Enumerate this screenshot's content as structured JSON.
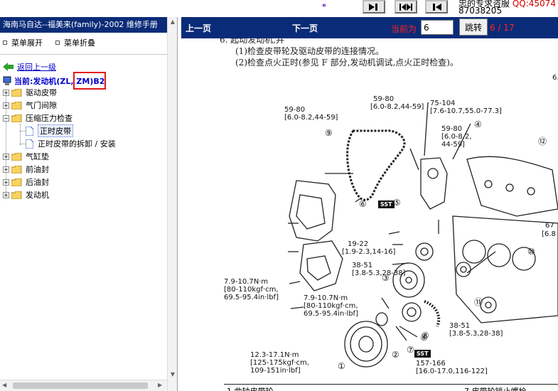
{
  "top": {
    "logo_text": "ᵉ",
    "support_line": "忠的专求咨服",
    "qq_text": "QQ:45074",
    "phone": "87038205"
  },
  "sidebar": {
    "book_title": "海南马自达--福美来(family)-2002 维修手册",
    "expand_label": "菜单展开",
    "collapse_label": "菜单折叠",
    "back_label": "返回上一级",
    "current_label": "当前:发动机(ZL, ZM)B2",
    "items": [
      {
        "label": "驱动皮带"
      },
      {
        "label": "气门间隙"
      },
      {
        "label": "压缩压力检查"
      },
      {
        "label": "正时皮带"
      },
      {
        "label": "正时皮带的拆卸 / 安装"
      },
      {
        "label": "气缸垫"
      },
      {
        "label": "前油封"
      },
      {
        "label": "后油封"
      },
      {
        "label": "发动机"
      }
    ]
  },
  "nav": {
    "prev": "上一页",
    "next": "下一页",
    "current_label": "当前为",
    "page_value": "6",
    "jump": "跳转",
    "page_count": "6 / 17"
  },
  "document": {
    "step_line": "6. 起动发动机,并",
    "sub1": "(1)检查皮带轮及驱动皮带的连接情况。",
    "sub2": "(2)检查点火正时(参见 F 部分,发动机调试,点火正时检查)。",
    "labels": {
      "t1": "59-80",
      "t1b": "[6.0-8.2,44-59]",
      "t2": "59-80",
      "t2b": "[6.0-8.2,44-59]",
      "t3": "75-104",
      "t3b": "[7.6-10.7,55.0-77.3]",
      "t4": "59-80",
      "t4b": "[6.0-8.2,",
      "t4c": "44-59]",
      "t5": "19-22",
      "t5b": "[1.9-2.3,14-16]",
      "t6": "38-51",
      "t6b": "[3.8-5.3,28-38]",
      "t7": "7.9-10.7N·m",
      "t7b": "[80-110kgf·cm,",
      "t7c": "69.5-95.4in·lbf]",
      "t8": "7.9-10.7N·m",
      "t8b": "[80-110kgf·cm,",
      "t8c": "69.5-95.4in·lbf]",
      "t9": "38-51",
      "t9b": "[3.8-5.3,28-38]",
      "t10": "12.3-17.1N·m",
      "t10b": "[125-175kgf·cm,",
      "t10c": "109-151in·lbf]",
      "t11": "157-166",
      "t11b": "[16.0-17.0,116-122]",
      "t12": "6.",
      "t12b": "67",
      "t12c": "[6.8",
      "sst1": "SST",
      "sst2": "SST",
      "n1": "①",
      "n2": "②",
      "n3": "③",
      "n4": "④",
      "n5": "⑤",
      "n6": "⑥",
      "n6b": "⑥",
      "n7": "⑦",
      "n8": "⑧",
      "n9": "⑨",
      "n10": "⑩",
      "n11": "⑪",
      "n12": "⑫"
    },
    "table_left": "1      曲轴皮带轮",
    "table_right": "7      皮带轮锁止螺栓"
  },
  "colors": {
    "header_blue": "#0a2c78",
    "accent_red": "#e01818",
    "link_blue": "#0000cc"
  }
}
